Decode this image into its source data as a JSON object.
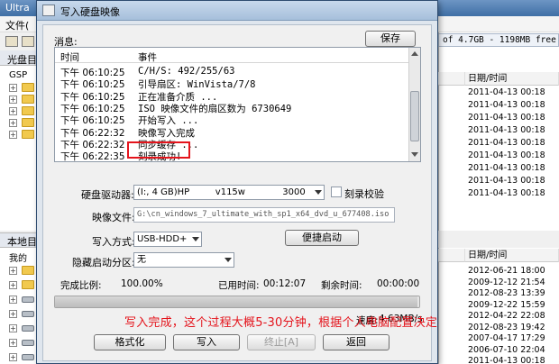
{
  "background_window": {
    "title": "Ultra",
    "menu_file": "文件(",
    "left_top_label": "光盘目",
    "tree_top_label": "GSP",
    "left_bottom_label": "本地目",
    "tree_bottom_label": "我的",
    "free_space": "of 4.7GB - 1198MB free",
    "col_header_top": "日期/时间",
    "col_header_bottom": "日期/时间",
    "top_dates": [
      "2011-04-13 00:18",
      "2011-04-13 00:18",
      "2011-04-13 00:18",
      "2011-04-13 00:18",
      "2011-04-13 00:18",
      "2011-04-13 00:18",
      "2011-04-13 00:18",
      "2011-04-13 00:18",
      "2011-04-13 00:18"
    ],
    "bottom_dates": [
      "2012-06-21 18:00",
      "2009-12-12 21:54",
      "2012-08-23 13:39",
      "2009-12-22 15:59",
      "2012-04-22 22:08",
      "2012-08-23 19:42",
      "2007-04-17 17:29",
      "2006-07-10 22:04",
      "2011-04-13 00:18"
    ]
  },
  "dialog": {
    "title": "写入硬盘映像",
    "messages_label": "消息:",
    "save_button": "保存",
    "log_columns": {
      "time": "时间",
      "event": "事件"
    },
    "log_rows": [
      {
        "time": "下午 06:10:25",
        "event": "C/H/S: 492/255/63"
      },
      {
        "time": "下午 06:10:25",
        "event": "引导扇区: WinVista/7/8"
      },
      {
        "time": "下午 06:10:25",
        "event": "正在准备介质 ..."
      },
      {
        "time": "下午 06:10:25",
        "event": "ISO 映像文件的扇区数为 6730649"
      },
      {
        "time": "下午 06:10:25",
        "event": "开始写入 ..."
      },
      {
        "time": "下午 06:22:32",
        "event": "映像写入完成"
      },
      {
        "time": "下午 06:22:32",
        "event": "同步缓存 ..."
      },
      {
        "time": "下午 06:22:35",
        "event": "刻录成功!"
      }
    ],
    "drive_label": "硬盘驱动器:",
    "drive_value": "(I:, 4 GB)HP         v115w             3000",
    "verify_label": "刻录校验",
    "image_file_label": "映像文件:",
    "image_file_value": "G:\\cn_windows_7_ultimate_with_sp1_x64_dvd_u_677408.iso",
    "write_method_label": "写入方式:",
    "write_method_value": "USB-HDD+",
    "boot_button": "便捷启动",
    "hidden_partition_label": "隐藏启动分区:",
    "hidden_partition_value": "无",
    "progress_label": "完成比例:",
    "progress_value": "100.00%",
    "progress_fraction": 0.995,
    "elapsed_label": "已用时间:",
    "elapsed_value": "00:12:07",
    "remaining_label": "剩余时间:",
    "remaining_value": "00:00:00",
    "speed_label": "速度:",
    "speed_value": "4.63MB/s",
    "annotation": "写入完成，这个过程大概5-30分钟，根据个人电脑配置决定",
    "buttons": {
      "format": "格式化",
      "write": "写入",
      "stop": "终止[A]",
      "back": "返回"
    }
  }
}
